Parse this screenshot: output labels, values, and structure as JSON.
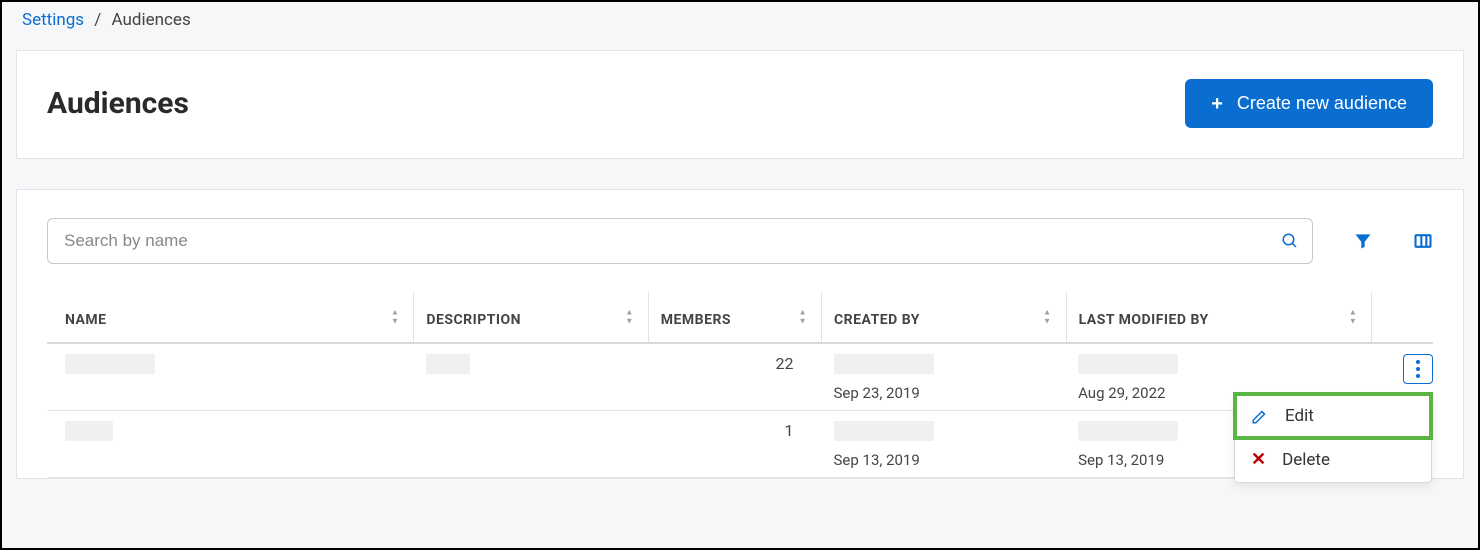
{
  "breadcrumb": {
    "parent": "Settings",
    "separator": "/",
    "current": "Audiences"
  },
  "header": {
    "title": "Audiences",
    "create_button": "Create new audience"
  },
  "toolbar": {
    "search_placeholder": "Search by name"
  },
  "table": {
    "columns": {
      "name": "NAME",
      "description": "DESCRIPTION",
      "members": "MEMBERS",
      "created_by": "CREATED BY",
      "last_modified_by": "LAST MODIFIED BY"
    },
    "rows": [
      {
        "members": "22",
        "created_date": "Sep 23, 2019",
        "modified_date": "Aug 29, 2022"
      },
      {
        "members": "1",
        "created_date": "Sep 13, 2019",
        "modified_date": "Sep 13, 2019"
      }
    ]
  },
  "menu": {
    "edit": "Edit",
    "delete": "Delete"
  },
  "colors": {
    "primary": "#0a6ed1",
    "danger": "#bb0000",
    "highlight": "#5bb543"
  }
}
